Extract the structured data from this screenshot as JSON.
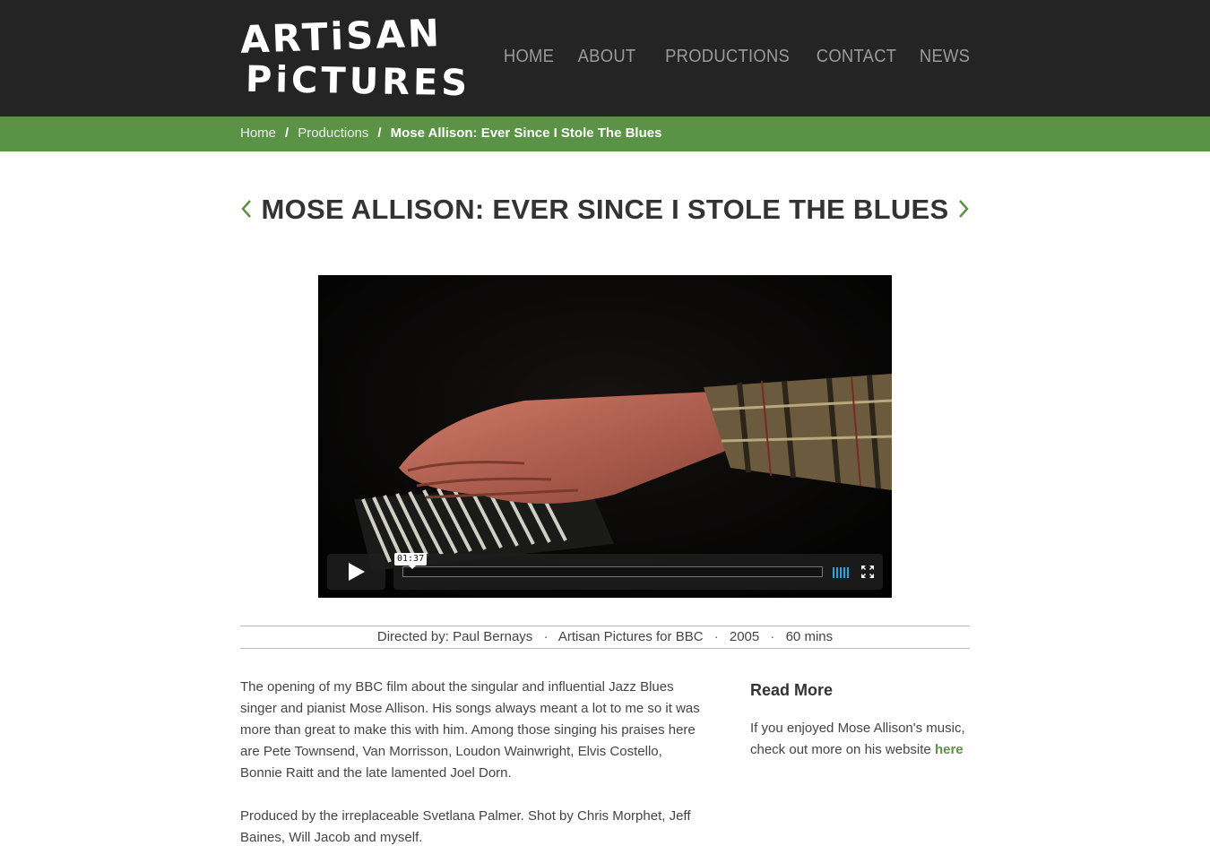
{
  "header": {
    "logo": {
      "line1": "ARTiSAN",
      "line2": "PiCTURES"
    },
    "nav": [
      "HOME",
      "ABOUT",
      "PRODUCTIONS",
      "CONTACT",
      "NEWS"
    ]
  },
  "breadcrumb": {
    "home": "Home",
    "productions": "Productions",
    "current": "Mose Allison: Ever Since I Stole The Blues",
    "separator": "/"
  },
  "page": {
    "title": "MOSE ALLISON: EVER SINCE I STOLE THE BLUES"
  },
  "video": {
    "time_tooltip": "01:37",
    "colors": {
      "volume": "#2aa3e0"
    }
  },
  "meta": {
    "director": "Directed by: Paul Bernays",
    "company": "Artisan Pictures for BBC",
    "year": "2005",
    "duration": "60 mins",
    "dot": "·"
  },
  "description": {
    "p1": "The opening of my BBC film about the singular and influential Jazz Blues singer and pianist Mose Allison. His songs always meant a lot to me so it was more than great to make this with him. Among those singing his praises here are Pete Townsend, Van Morrisson, Loudon Wainwright, Elvis Costello, Bonnie Raitt and the late lamented Joel Dorn.",
    "p2": "Produced by the irreplaceable Svetlana Palmer. Shot by Chris Morphet, Jeff Baines, Will Jacob and myself."
  },
  "aside": {
    "heading": "Read More",
    "text": "If you enjoyed Mose Allison's music, check out more on his website ",
    "link": "here"
  },
  "colors": {
    "header_bg": "#242424",
    "accent_green": "#5a9346"
  }
}
